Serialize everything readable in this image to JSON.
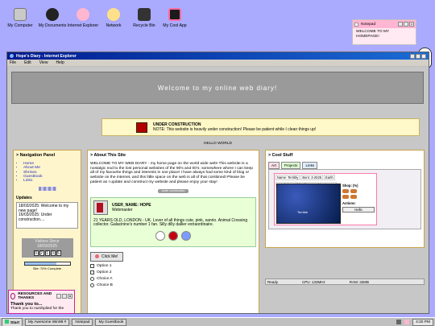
{
  "desktop": {
    "icons": [
      {
        "name": "my-computer-icon",
        "label": "My Computer"
      },
      {
        "name": "my-documents-icon",
        "label": "My Documents"
      },
      {
        "name": "internet-explorer-icon",
        "label": "Internet Explorer"
      },
      {
        "name": "network-icon",
        "label": "Network"
      },
      {
        "name": "recycle-bin-icon",
        "label": "Recycle Bin"
      },
      {
        "name": "my-cool-app-icon",
        "label": "My Cool App"
      }
    ]
  },
  "notepad": {
    "title": "Notepad",
    "content": "WELCOME TO MY HOMEPAGE!"
  },
  "browser": {
    "title": "Hope's Diary - Internet Explorer",
    "menu": [
      "File",
      "Edit",
      "View",
      "Help"
    ],
    "banner": "Welcome to my online web diary!",
    "under_construction": {
      "title": "UNDER CONSTRUCTION",
      "note": "NOTE: This website is heavily under construction! Please be patient while I clean things up!"
    },
    "hello": "HELLO WORLD",
    "nav": {
      "title": "> Navigation Panel",
      "links": [
        "Home",
        "About Me",
        "Shrines",
        "Guestbook",
        "Links"
      ],
      "updates_title": "Updates",
      "updates": [
        "18/03/2025: Welcome to my new page!",
        "16/03/2025: Under construction...."
      ],
      "visitors_label": "Visitors Since",
      "visitors_date": "18/03/2025",
      "visitor_digits": [
        "0",
        "2",
        "1",
        "3",
        "5"
      ],
      "progress_value": 0.7,
      "progress_label": "Site: 70% Complete"
    },
    "about": {
      "title": "> About This Site",
      "text": "WELCOME TO MY WEB DIARY - my home page on the world wide web! This website is a nostalgic nod to the lost personal websites of the 90's and 00's; somewhere where I can keep all of my favourite things and interests in one place! I have always had some kind of blog or website on the internet, and this little space on the web is all of that combined! Please be patient as I update and construct my website and please enjoy your stay!",
      "badge": "under construction",
      "user_name": "USER_NAME: HOPE",
      "role": "Webmaster",
      "bio": "21 YEARS OLD, LONDON - UK. Lover of all things cute, pink, sanrio. Animal Crossing collector. Galacinine's number 1 fan. Silly dilly dallier extraordinaire.",
      "click_button": "Click Me!",
      "options": [
        "Option 1",
        "Option 2"
      ],
      "choices": [
        "Choice A",
        "Choice B"
      ]
    },
    "cool": {
      "title": "> Cool Stuff",
      "tabs": [
        "Art",
        "Projects",
        "Links"
      ],
      "card": {
        "name": "Name: Terribly",
        "born": "Born: 3-2025",
        "place": "Earth",
        "mood": "Mood: $%%$",
        "belly": "Belly: ####",
        "coins": "Coins: 10",
        "shop": "Shop: (%)",
        "actions": "Actions:",
        "action_button": "Hello",
        "scene_label": "Terrible"
      },
      "status": {
        "ready": "Ready",
        "cpu": "CPU: 133MHz",
        "ram": "RAM: 32MB"
      }
    },
    "resources": {
      "title": "RESOURCES AND THANKS",
      "thanks_title": "Thank you to...",
      "thanks_text": "Thank you to numbplied for the"
    }
  },
  "taskbar": {
    "start": "Start",
    "tasks": [
      "My Awesome Win98 #",
      "Notepad",
      "My Guestbook"
    ],
    "clock": "4:20 PM"
  }
}
